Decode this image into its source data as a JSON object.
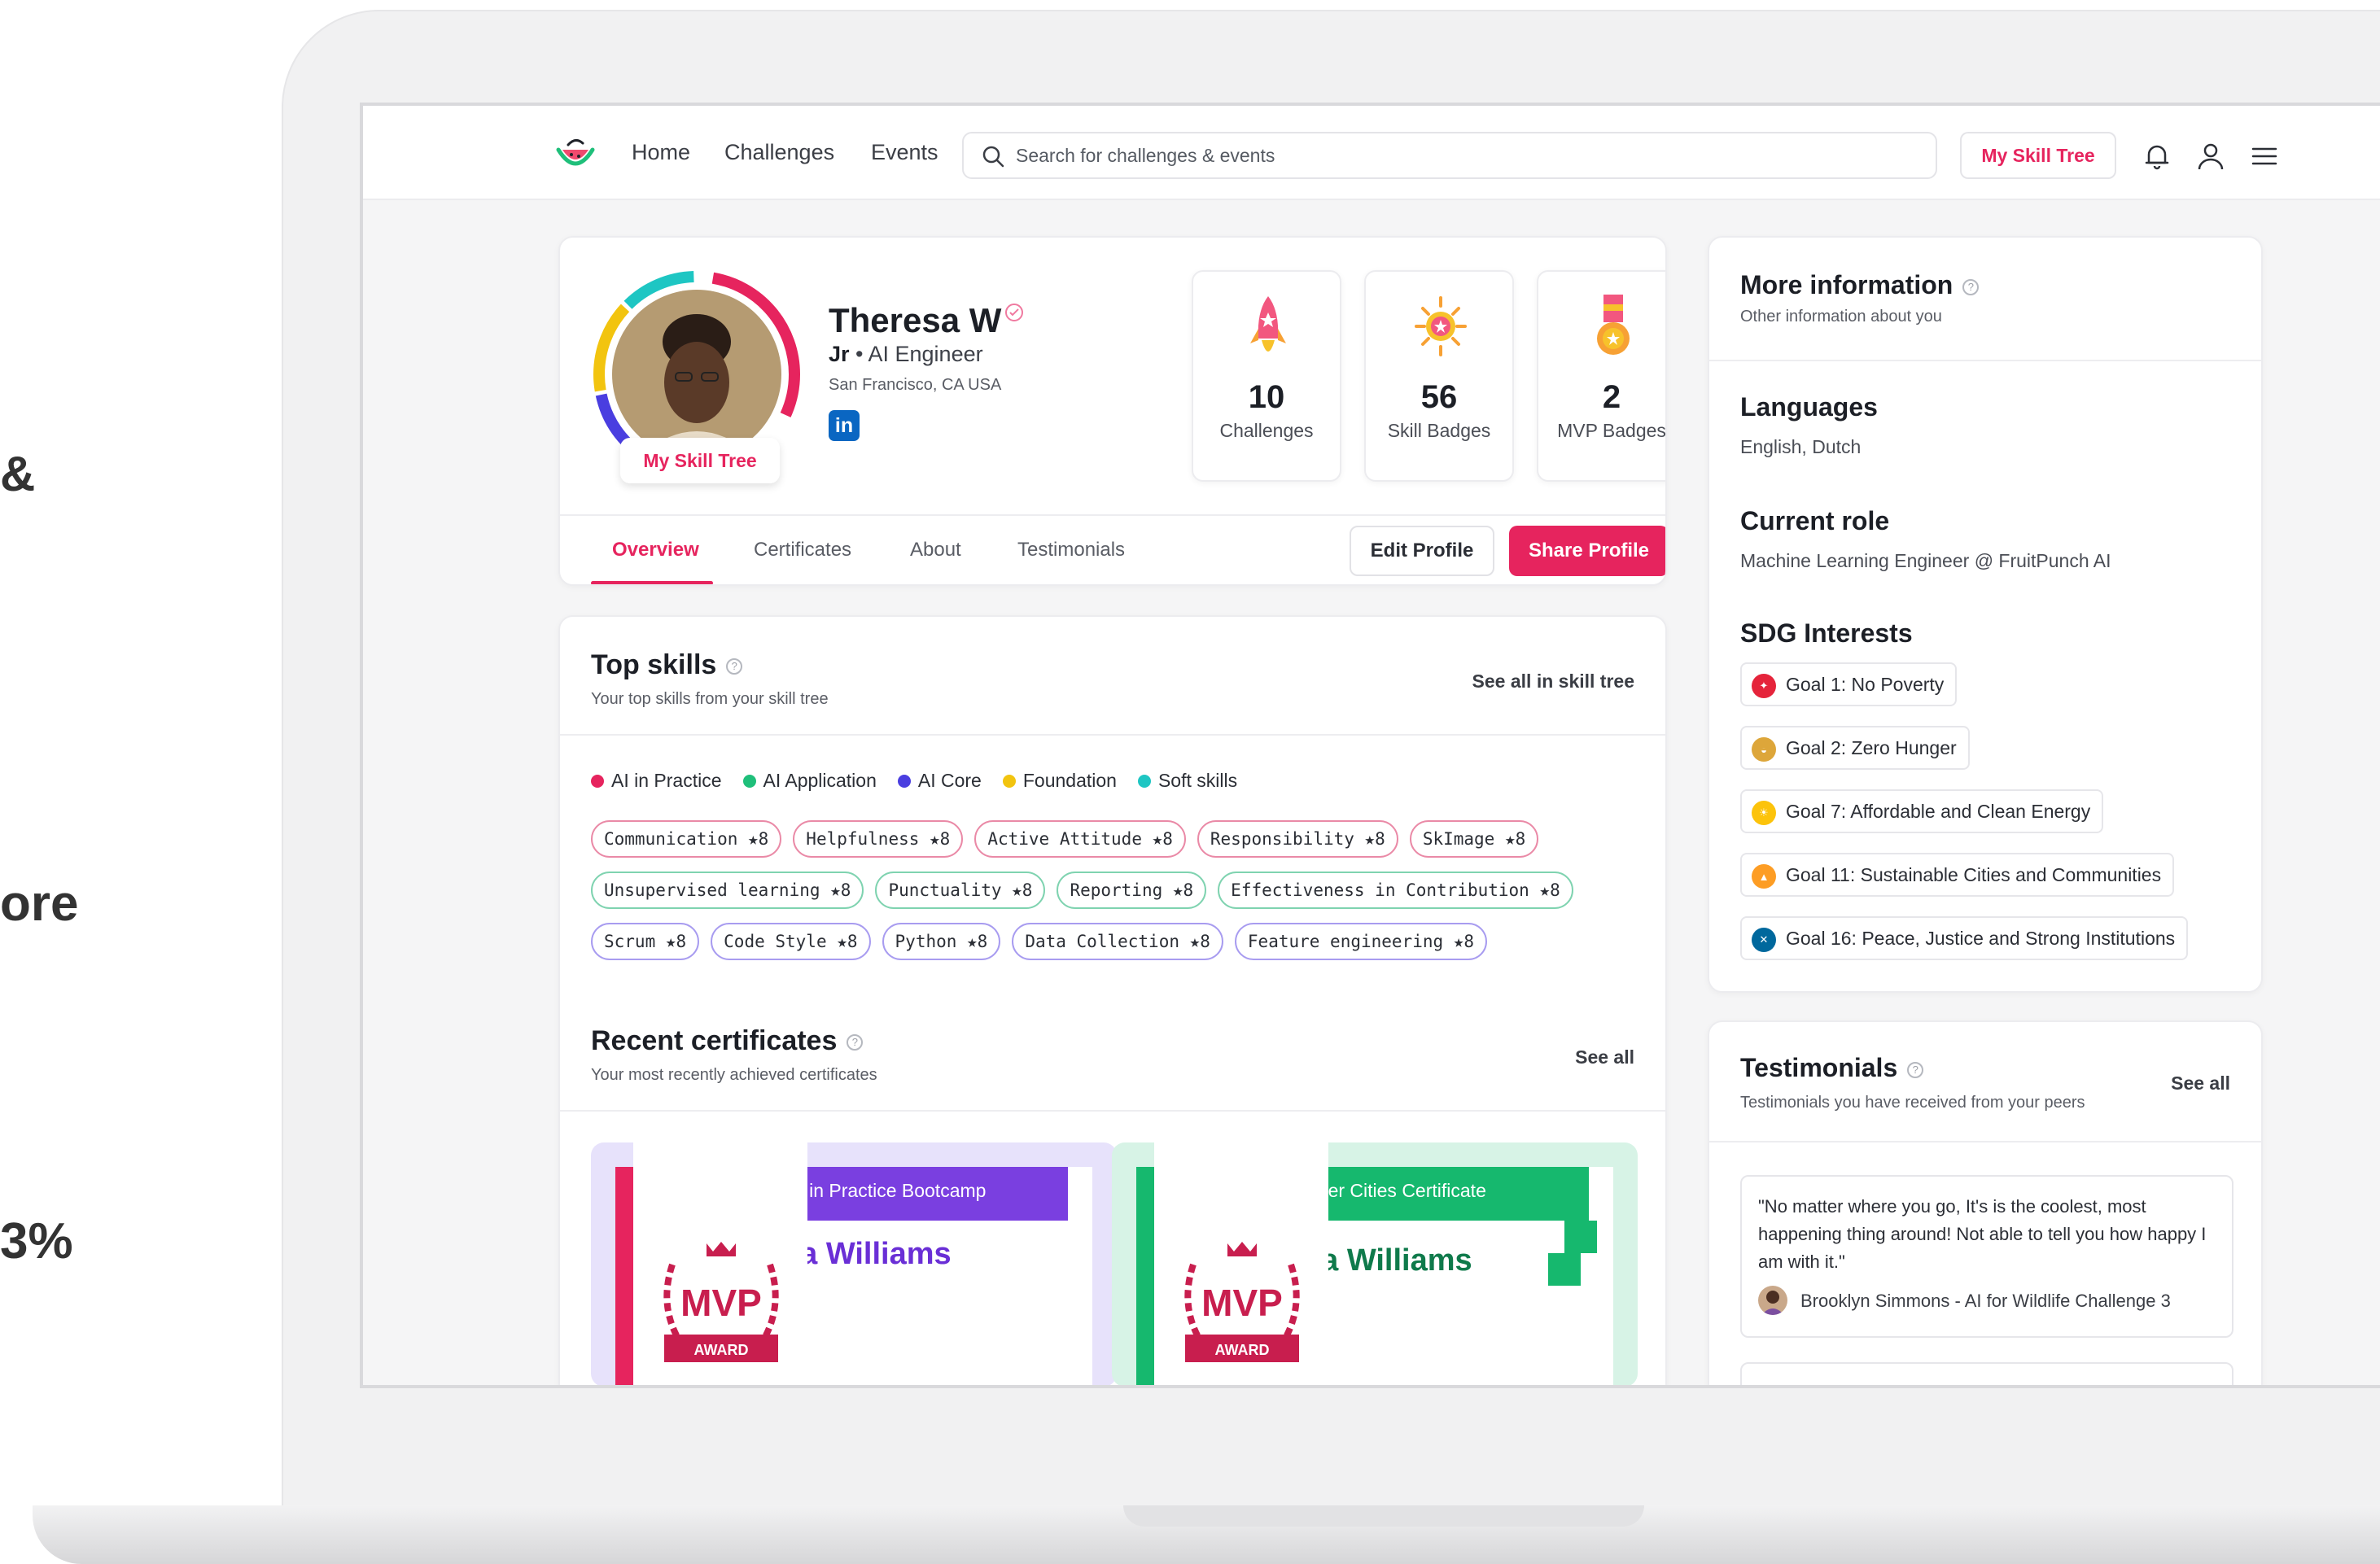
{
  "side_fragments": [
    "&",
    "ore",
    "3%"
  ],
  "nav": {
    "links": [
      "Home",
      "Challenges",
      "Events"
    ],
    "search_placeholder": "Search for challenges & events",
    "skill_tree_label": "My Skill Tree"
  },
  "profile": {
    "name": "Theresa W",
    "level": "Jr",
    "role": " • AI Engineer",
    "location": "San Francisco, CA USA",
    "linkedin_label": "in",
    "skill_tree_pill": "My Skill Tree",
    "stats": [
      {
        "value": "10",
        "label": "Challenges"
      },
      {
        "value": "56",
        "label": "Skill Badges"
      },
      {
        "value": "2",
        "label": "MVP Badges"
      }
    ],
    "tabs": [
      "Overview",
      "Certificates",
      "About",
      "Testimonials"
    ],
    "edit_label": "Edit Profile",
    "share_label": "Share Profile"
  },
  "top_skills": {
    "title": "Top skills",
    "subtitle": "Your top skills from your skill tree",
    "see_all": "See all in skill tree",
    "legend": [
      {
        "label": "AI in Practice",
        "color": "#e6245e"
      },
      {
        "label": "AI Application",
        "color": "#1fbf7a"
      },
      {
        "label": "AI Core",
        "color": "#4a3ee0"
      },
      {
        "label": "Foundation",
        "color": "#f2c40f"
      },
      {
        "label": "Soft skills",
        "color": "#1ec6c3"
      }
    ],
    "rows": [
      [
        {
          "label": "Communication ★8",
          "tone": "red"
        },
        {
          "label": "Helpfulness ★8",
          "tone": "red"
        },
        {
          "label": "Active Attitude ★8",
          "tone": "red"
        },
        {
          "label": "Responsibility ★8",
          "tone": "red"
        },
        {
          "label": "SkImage ★8",
          "tone": "red"
        }
      ],
      [
        {
          "label": "Unsupervised learning ★8",
          "tone": "green"
        },
        {
          "label": "Punctuality ★8",
          "tone": "green"
        },
        {
          "label": "Reporting ★8",
          "tone": "green"
        },
        {
          "label": "Effectiveness in Contribution ★8",
          "tone": "green"
        }
      ],
      [
        {
          "label": "Scrum ★8",
          "tone": "blue"
        },
        {
          "label": "Code Style ★8",
          "tone": "blue"
        },
        {
          "label": "Python ★8",
          "tone": "blue"
        },
        {
          "label": "Data Collection ★8",
          "tone": "blue"
        },
        {
          "label": "Feature engineering ★8",
          "tone": "blue"
        }
      ]
    ]
  },
  "recent_certificates": {
    "title": "Recent certificates",
    "subtitle": "Your most recently achieved certificates",
    "see_all": "See all",
    "items": [
      {
        "title": "AI in Practice Bootcamp",
        "name": "sa Williams",
        "mvp": "MVP",
        "award": "AWARD",
        "accent": "#7a3fe0"
      },
      {
        "title": "ener Cities Certificate",
        "name": "sa Williams",
        "mvp": "MVP",
        "award": "AWARD",
        "accent": "#16b86e"
      }
    ]
  },
  "more_info": {
    "title": "More information",
    "subtitle": "Other information about you",
    "languages_label": "Languages",
    "languages": "English, Dutch",
    "role_label": "Current role",
    "role": "Machine Learning Engineer @ FruitPunch AI",
    "sdg_label": "SDG Interests",
    "sdgs": [
      {
        "label": "Goal 1: No Poverty",
        "color": "#e5243b"
      },
      {
        "label": "Goal 2: Zero Hunger",
        "color": "#dda63a"
      },
      {
        "label": "Goal 7: Affordable and Clean Energy",
        "color": "#fcc30b"
      },
      {
        "label": "Goal 11: Sustainable Cities and Communities",
        "color": "#fd9d24"
      },
      {
        "label": "Goal 16: Peace, Justice and Strong Institutions",
        "color": "#00689d"
      }
    ]
  },
  "testimonials": {
    "title": "Testimonials",
    "subtitle": "Testimonials you have received from your peers",
    "see_all": "See all",
    "quote": "\"No matter where you go, It's is the coolest, most happening thing around! Not able to tell you how happy I am with it.\"",
    "author": "Brooklyn Simmons - AI for Wildlife Challenge 3"
  }
}
